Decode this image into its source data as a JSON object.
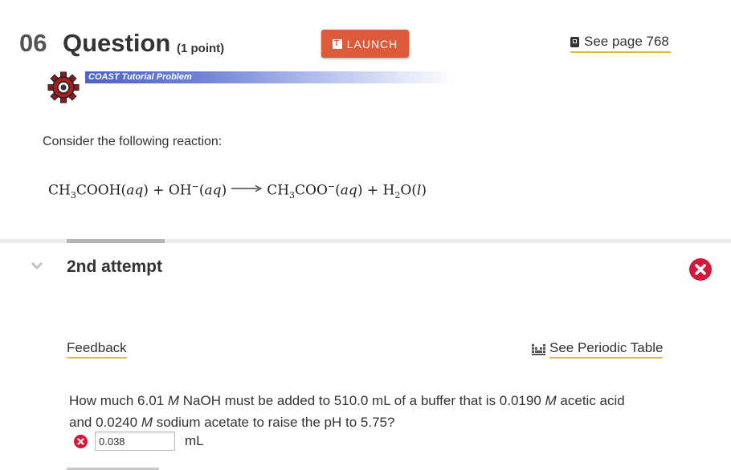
{
  "header": {
    "question_number": "06",
    "question_label": "Question",
    "points": "(1 point)",
    "launch_label": "LAUNCH",
    "launch_icon_letter": "T",
    "see_page_label": "See page 768",
    "see_page_icon": "book-icon"
  },
  "banner": {
    "label": "COAST Tutorial Problem",
    "icon": "gear-icon",
    "color": "#4f63c8"
  },
  "prompt": {
    "intro": "Consider the following reaction:",
    "reaction": "CH3COOH(aq) + OH−(aq) ⟶ CH3COO−(aq) + H2O(l)"
  },
  "attempt": {
    "label": "2nd attempt",
    "status_icon": "incorrect-icon",
    "status_color": "#d6173a"
  },
  "links": {
    "feedback": "Feedback",
    "periodic_table": "See Periodic Table",
    "underline_color": "#e0b93a"
  },
  "question": {
    "line1_part1": "How much 6.01 ",
    "line1_M1": "M",
    "line1_part2": " NaOH must be added to 510.0 mL of a buffer that is 0.0190 ",
    "line1_M2": "M",
    "line1_part3": " acetic acid",
    "line2_part1": "and 0.0240 ",
    "line2_M": "M",
    "line2_part2": " sodium acetate to raise the pH to 5.75?"
  },
  "answer": {
    "value": "0.038",
    "unit": "mL",
    "status_icon": "incorrect-icon"
  },
  "colors": {
    "launch": "#dd5a3a",
    "text": "#333333"
  }
}
